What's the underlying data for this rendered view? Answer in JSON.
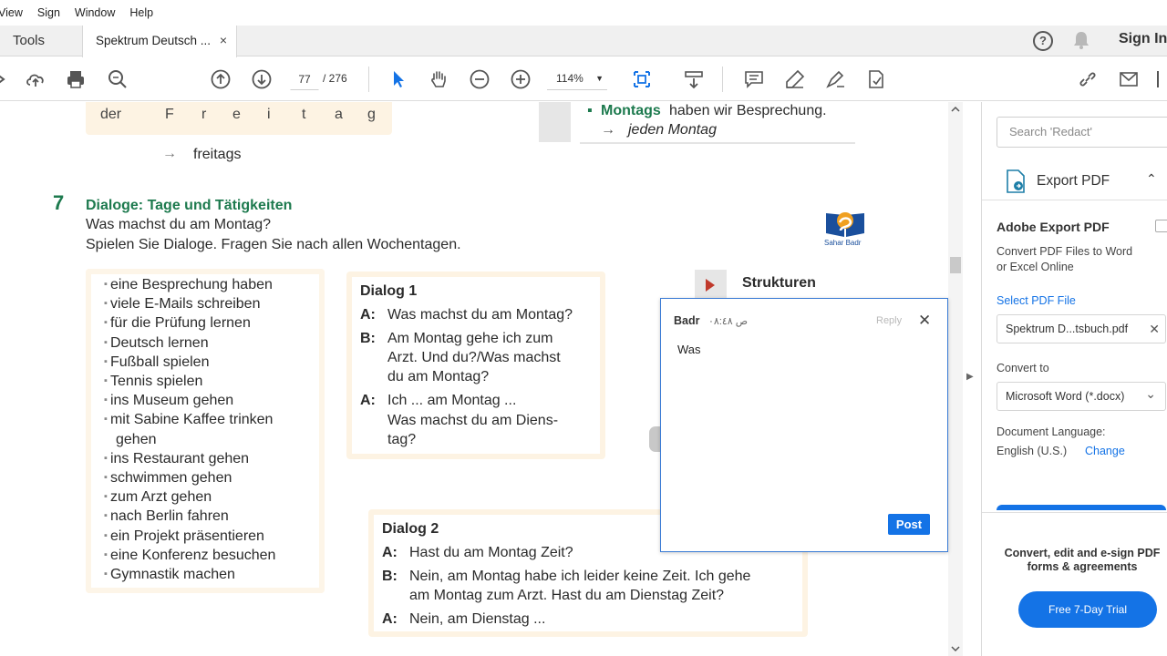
{
  "menu": [
    "View",
    "Sign",
    "Window",
    "Help"
  ],
  "tabs": {
    "tools": "Tools",
    "document": "Spektrum Deutsch ...",
    "close": "×"
  },
  "header": {
    "help": "?",
    "sign_in": "Sign In"
  },
  "toolbar": {
    "page_current": "77",
    "page_total": "/  276",
    "zoom": "114%",
    "zoom_caret": "▼"
  },
  "page": {
    "letters": [
      "der",
      "F",
      "r",
      "e",
      "i",
      "t",
      "a",
      "g"
    ],
    "arrow": "→",
    "freitags": "freitags",
    "montags_bullet": "▪",
    "montags_green": "Montags",
    "montags_rest": "haben wir Besprechung.",
    "jeden": "jeden Montag",
    "exercise_number": "7",
    "exercise_title": "Dialoge: Tage und Tätigkeiten",
    "exercise_q1": "Was machst du am Montag?",
    "exercise_q2": "Spielen Sie Dialoge. Fragen Sie nach allen Wochentagen.",
    "activities": [
      "eine Besprechung haben",
      "viele E-Mails schreiben",
      "für die Prüfung lernen",
      "Deutsch lernen",
      "Fußball spielen",
      "Tennis spielen",
      "ins Museum gehen",
      "mit Sabine Kaffee trinken",
      "gehen",
      "ins Restaurant gehen",
      "schwimmen gehen",
      "zum Arzt gehen",
      "nach Berlin fahren",
      "ein Projekt präsentieren",
      "eine Konferenz besuchen",
      "Gymnastik machen"
    ],
    "dialog1": {
      "title": "Dialog 1",
      "lines": [
        {
          "speaker": "A:",
          "text": [
            "Was machst du am Montag?"
          ]
        },
        {
          "speaker": "B:",
          "text": [
            "Am Montag gehe ich zum",
            "Arzt. Und du?/Was machst",
            "du am Montag?"
          ]
        },
        {
          "speaker": "A:",
          "text": [
            "Ich ... am Montag ...",
            "Was machst du am Diens-",
            "tag?"
          ]
        }
      ]
    },
    "dialog2": {
      "title": "Dialog 2",
      "lines": [
        {
          "speaker": "A:",
          "text": [
            "Hast du am Montag Zeit?"
          ]
        },
        {
          "speaker": "B:",
          "text": [
            "Nein, am Montag habe ich leider keine Zeit. Ich gehe",
            "am Montag zum Arzt. Hast du am Dienstag Zeit?"
          ]
        },
        {
          "speaker": "A:",
          "text": [
            "Nein, am Dienstag ..."
          ]
        }
      ]
    },
    "strukturen": "Strukturen",
    "watermark_text": "Sahar Badr"
  },
  "comment": {
    "author": "Badr",
    "time": "ص ٠٨:٤٨",
    "reply": "Reply",
    "close": "✕",
    "text": "Was",
    "post": "Post"
  },
  "panel": {
    "search_placeholder": "Search 'Redact'",
    "export_title": "Export PDF",
    "chevron": "⌃",
    "adobe_title": "Adobe Export PDF",
    "desc1": "Convert PDF Files to Word",
    "desc2": "or Excel Online",
    "select_label": "Select PDF File",
    "file": "Spektrum D...tsbuch.pdf",
    "file_x": "✕",
    "convert_label": "Convert to",
    "convert_value": "Microsoft Word (*.docx)",
    "convert_chev": "⌄",
    "lang_label": "Document Language:",
    "lang_value": "English (U.S.)",
    "lang_change": "Change",
    "cta1": "Convert, edit and e-sign PDF",
    "cta2": "forms & agreements",
    "trial": "Free 7-Day Trial"
  },
  "colors": {
    "accent": "#1473e6",
    "green": "#1d7a4e"
  }
}
